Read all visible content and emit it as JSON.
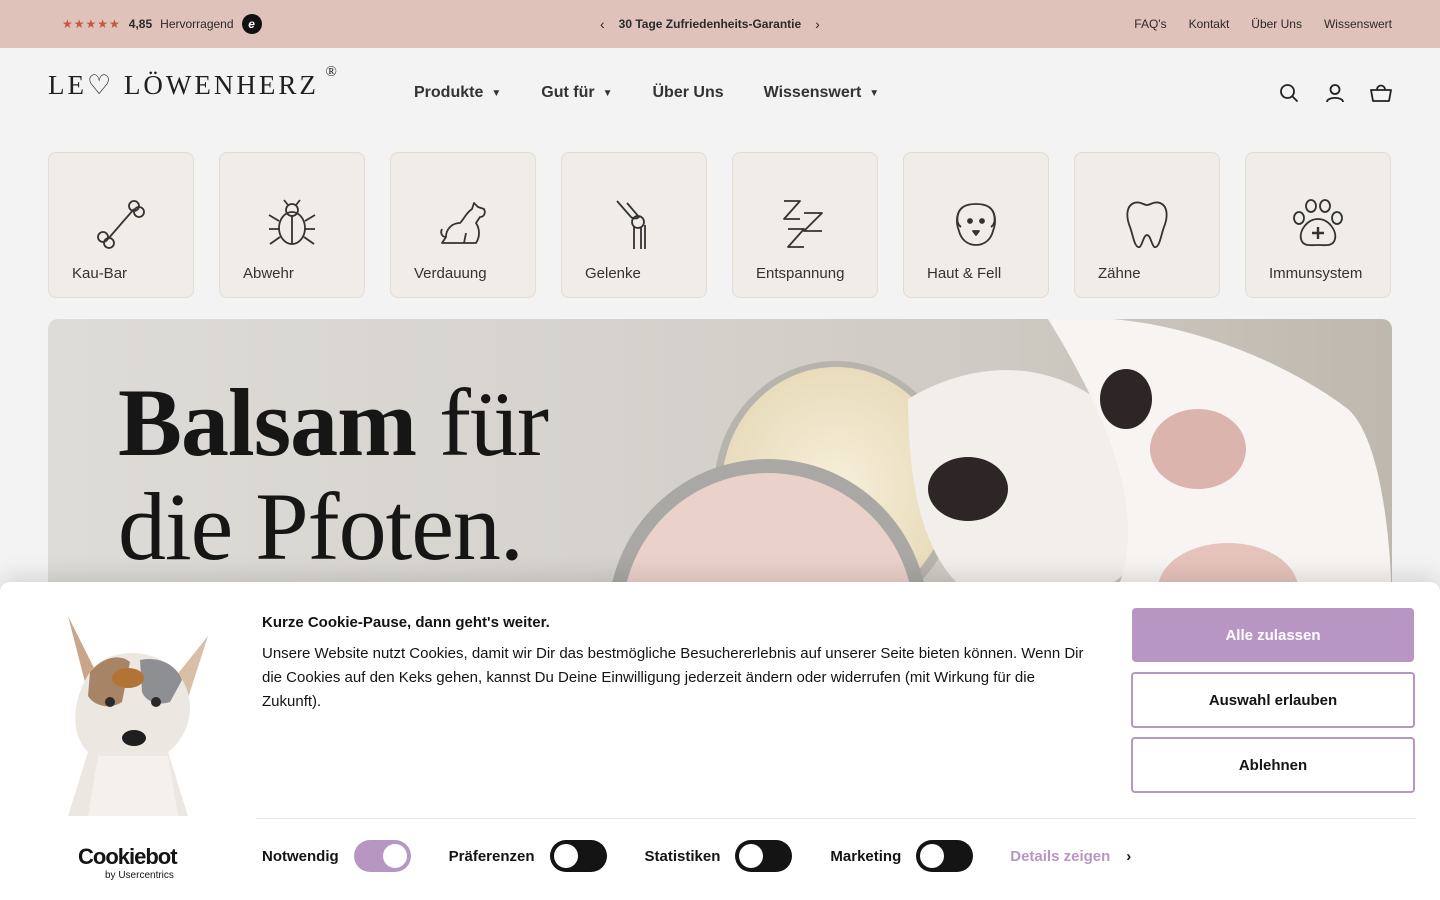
{
  "topbar": {
    "stars": "★★★★★",
    "score": "4,85",
    "rating_label": "Hervorragend",
    "badge": "e",
    "message": "30 Tage Zufriedenheits-Garantie",
    "prev_arrow": "‹",
    "next_arrow": "›",
    "links": [
      "FAQ's",
      "Kontakt",
      "Über Uns",
      "Wissenswert"
    ]
  },
  "header": {
    "logo": "LE♡ LÖWENHERZ",
    "logo_reg": "®",
    "nav": [
      {
        "label": "Produkte",
        "has_dropdown": true
      },
      {
        "label": "Gut für",
        "has_dropdown": true
      },
      {
        "label": "Über Uns",
        "has_dropdown": false
      },
      {
        "label": "Wissenswert",
        "has_dropdown": true
      }
    ],
    "icons": [
      "search-icon",
      "account-icon",
      "cart-icon"
    ]
  },
  "categories": [
    {
      "label": "Kau-Bar",
      "icon": "bone-icon"
    },
    {
      "label": "Abwehr",
      "icon": "bug-icon"
    },
    {
      "label": "Verdauung",
      "icon": "dog-sitting-icon"
    },
    {
      "label": "Gelenke",
      "icon": "joint-icon"
    },
    {
      "label": "Entspannung",
      "icon": "sleep-icon"
    },
    {
      "label": "Haut & Fell",
      "icon": "dog-face-icon"
    },
    {
      "label": "Zähne",
      "icon": "tooth-icon"
    },
    {
      "label": "Immunsystem",
      "icon": "paw-plus-icon"
    }
  ],
  "hero": {
    "line1_bold": "Balsam",
    "line1_rest": " für",
    "line2": "die Pfoten."
  },
  "cookie": {
    "title": "Kurze Cookie-Pause, dann geht's weiter.",
    "text": "Unsere Website nutzt Cookies, damit wir Dir das bestmögliche Besuchererlebnis auf unserer Seite bieten können. Wenn Dir die Cookies auf den Keks gehen, kannst Du Deine Einwilligung jederzeit ändern oder widerrufen (mit Wirkung für die Zukunft).",
    "btn_allow_all": "Alle zulassen",
    "btn_allow_selection": "Auswahl erlauben",
    "btn_decline": "Ablehnen",
    "brand": "Cookiebot",
    "brand_sub": "by Usercentrics",
    "toggles": [
      {
        "label": "Notwendig",
        "on": true
      },
      {
        "label": "Präferenzen",
        "on": false
      },
      {
        "label": "Statistiken",
        "on": false
      },
      {
        "label": "Marketing",
        "on": false
      }
    ],
    "details_label": "Details zeigen",
    "accent_color": "#b896c4"
  },
  "colors": {
    "topbar_bg": "#dfc2ba",
    "page_bg": "#f3f3f3",
    "tile_bg": "#f0ece7"
  }
}
